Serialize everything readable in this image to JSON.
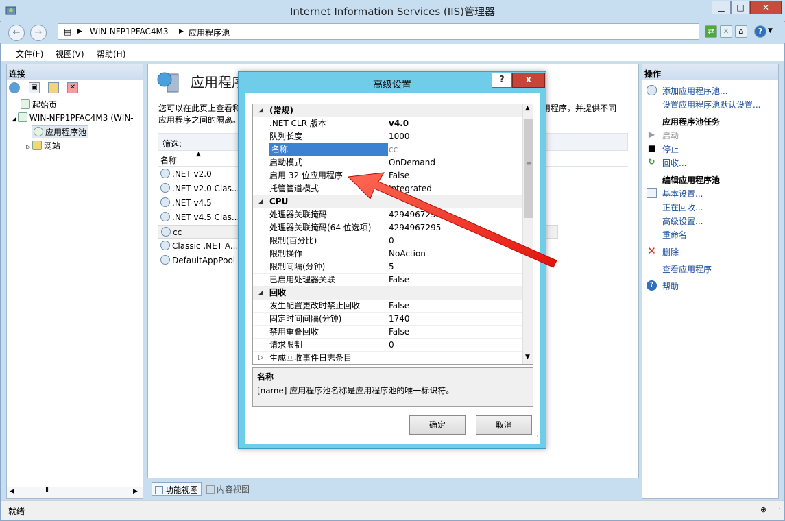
{
  "window": {
    "title": "Internet Information Services (IIS)管理器"
  },
  "address": {
    "segments": [
      "WIN-NFP1PFAC4M3",
      "应用程序池"
    ]
  },
  "menu": [
    "文件(F)",
    "视图(V)",
    "帮助(H)"
  ],
  "left_panel": {
    "header": "连接",
    "tree": {
      "start": "起始页",
      "server": "WIN-NFP1PFAC4M3 (WIN-",
      "app_pools": "应用程序池",
      "sites": "网站"
    }
  },
  "center": {
    "title": "应用程序",
    "description_left": "您可以在此页上查看和",
    "description_left2": "应用程序之间的隔离。",
    "description_right": "用程序，并提供不同",
    "filter_label": "筛选:",
    "col_name": "名称",
    "pools": [
      ".NET v2.0",
      ".NET v2.0 Clas...",
      ".NET v4.5",
      ".NET v4.5 Clas...",
      "cc",
      "Classic .NET A...",
      "DefaultAppPool"
    ],
    "tab_features": "功能视图",
    "tab_content": "内容视图"
  },
  "right_panel": {
    "header": "操作",
    "add_pool": "添加应用程序池...",
    "set_defaults": "设置应用程序池默认设置...",
    "tasks_header": "应用程序池任务",
    "start": "启动",
    "stop": "停止",
    "recycle": "回收...",
    "edit_header": "编辑应用程序池",
    "basic_settings": "基本设置...",
    "recycling": "正在回收...",
    "advanced_settings": "高级设置...",
    "rename": "重命名",
    "delete": "删除",
    "view_apps": "查看应用程序",
    "help": "帮助"
  },
  "status": {
    "text": "就绪"
  },
  "dialog": {
    "title": "高级设置",
    "help_btn": "?",
    "close_btn": "x",
    "rows": [
      {
        "type": "cat",
        "key": "(常规)",
        "toggle": "◢"
      },
      {
        "key": ".NET CLR 版本",
        "value": "v4.0",
        "bold": true
      },
      {
        "key": "队列长度",
        "value": "1000"
      },
      {
        "key": "名称",
        "value": "cc",
        "selected": true,
        "grey": true
      },
      {
        "key": "启动模式",
        "value": "OnDemand"
      },
      {
        "key": "启用 32 位应用程序",
        "value": "False"
      },
      {
        "key": "托管管道模式",
        "value": "Integrated"
      },
      {
        "type": "cat",
        "key": "CPU",
        "toggle": "◢"
      },
      {
        "key": "处理器关联掩码",
        "value": "4294967295"
      },
      {
        "key": "处理器关联掩码(64 位选项)",
        "value": "4294967295"
      },
      {
        "key": "限制(百分比)",
        "value": "0"
      },
      {
        "key": "限制操作",
        "value": "NoAction"
      },
      {
        "key": "限制间隔(分钟)",
        "value": "5"
      },
      {
        "key": "已启用处理器关联",
        "value": "False"
      },
      {
        "type": "cat",
        "key": "回收",
        "toggle": "◢"
      },
      {
        "key": "发生配置更改时禁止回收",
        "value": "False"
      },
      {
        "key": "固定时间间隔(分钟)",
        "value": "1740"
      },
      {
        "key": "禁用重叠回收",
        "value": "False"
      },
      {
        "key": "请求限制",
        "value": "0"
      },
      {
        "key": "生成回收事件日志条目",
        "value": "",
        "toggle": "▷"
      }
    ],
    "desc_title": "名称",
    "desc_text": "[name] 应用程序池名称是应用程序池的唯一标识符。",
    "ok": "确定",
    "cancel": "取消"
  },
  "colors": {
    "dialog_frame": "#6fcdea",
    "selection": "#3c82d2",
    "arrow": "#ff2a1f",
    "link": "#1a4f9a"
  }
}
